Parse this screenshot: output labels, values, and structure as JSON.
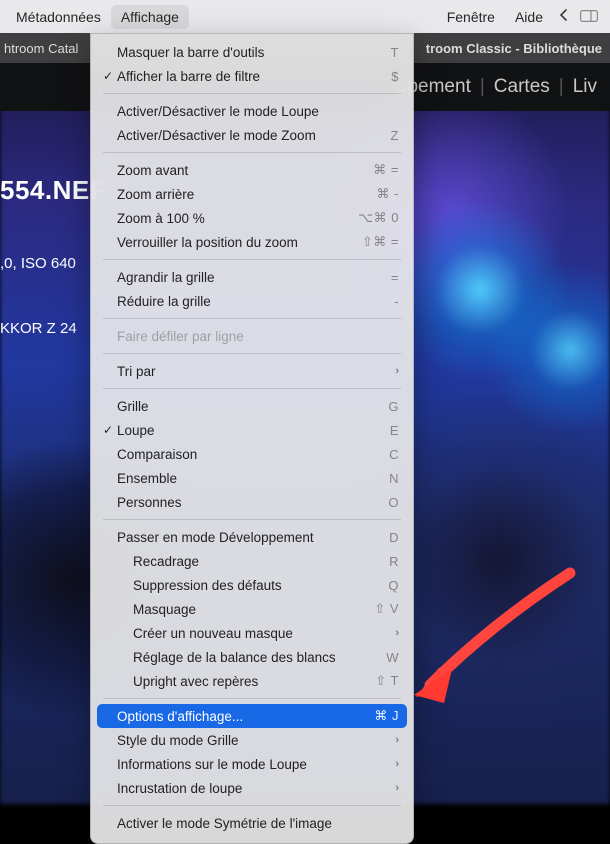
{
  "menubar": {
    "items": [
      "Métadonnées",
      "Affichage",
      "Fenêtre",
      "Aide"
    ],
    "active_index": 1
  },
  "titlebar": {
    "left": "htroom Catal",
    "right": "troom Classic - Bibliothèque"
  },
  "module_bar": {
    "items": [
      "ppement",
      "Cartes",
      "Liv"
    ]
  },
  "exif": {
    "filename": "554.NEF",
    "line1": ",0, ISO 640",
    "line2": "KKOR Z 24"
  },
  "menu": {
    "items": [
      {
        "type": "item",
        "label": "Masquer la barre d'outils",
        "accel": "T"
      },
      {
        "type": "item",
        "label": "Afficher la barre de filtre",
        "checked": true,
        "accel": "$"
      },
      {
        "type": "sep"
      },
      {
        "type": "item",
        "label": "Activer/Désactiver le mode Loupe"
      },
      {
        "type": "item",
        "label": "Activer/Désactiver le mode Zoom",
        "accel": "Z"
      },
      {
        "type": "sep"
      },
      {
        "type": "item",
        "label": "Zoom avant",
        "accel": "⌘ ="
      },
      {
        "type": "item",
        "label": "Zoom arrière",
        "accel": "⌘ -"
      },
      {
        "type": "item",
        "label": "Zoom à 100 %",
        "accel": "⌥⌘ 0"
      },
      {
        "type": "item",
        "label": "Verrouiller la position du zoom",
        "accel": "⇧⌘ ="
      },
      {
        "type": "sep"
      },
      {
        "type": "item",
        "label": "Agrandir la grille",
        "accel": "="
      },
      {
        "type": "item",
        "label": "Réduire la grille",
        "accel": "-"
      },
      {
        "type": "sep"
      },
      {
        "type": "item",
        "label": "Faire défiler par ligne",
        "disabled": true
      },
      {
        "type": "sep"
      },
      {
        "type": "item",
        "label": "Tri par",
        "submenu": true
      },
      {
        "type": "sep"
      },
      {
        "type": "item",
        "label": "Grille",
        "accel": "G"
      },
      {
        "type": "item",
        "label": "Loupe",
        "checked": true,
        "accel": "E"
      },
      {
        "type": "item",
        "label": "Comparaison",
        "accel": "C"
      },
      {
        "type": "item",
        "label": "Ensemble",
        "accel": "N"
      },
      {
        "type": "item",
        "label": "Personnes",
        "accel": "O"
      },
      {
        "type": "sep"
      },
      {
        "type": "item",
        "label": "Passer en mode Développement",
        "accel": "D"
      },
      {
        "type": "item",
        "label": "Recadrage",
        "indent": true,
        "accel": "R"
      },
      {
        "type": "item",
        "label": "Suppression des défauts",
        "indent": true,
        "accel": "Q"
      },
      {
        "type": "item",
        "label": "Masquage",
        "indent": true,
        "accel": "⇧ V"
      },
      {
        "type": "item",
        "label": "Créer un nouveau masque",
        "indent": true,
        "submenu": true
      },
      {
        "type": "item",
        "label": "Réglage de la balance des blancs",
        "indent": true,
        "accel": "W"
      },
      {
        "type": "item",
        "label": "Upright avec repères",
        "indent": true,
        "accel": "⇧ T"
      },
      {
        "type": "sep"
      },
      {
        "type": "item",
        "label": "Options d'affichage...",
        "highlight": true,
        "accel": "⌘ J"
      },
      {
        "type": "item",
        "label": "Style du mode Grille",
        "submenu": true
      },
      {
        "type": "item",
        "label": "Informations sur le mode Loupe",
        "submenu": true
      },
      {
        "type": "item",
        "label": "Incrustation de loupe",
        "submenu": true
      },
      {
        "type": "sep"
      },
      {
        "type": "item",
        "label": "Activer le mode Symétrie de l'image"
      }
    ]
  }
}
